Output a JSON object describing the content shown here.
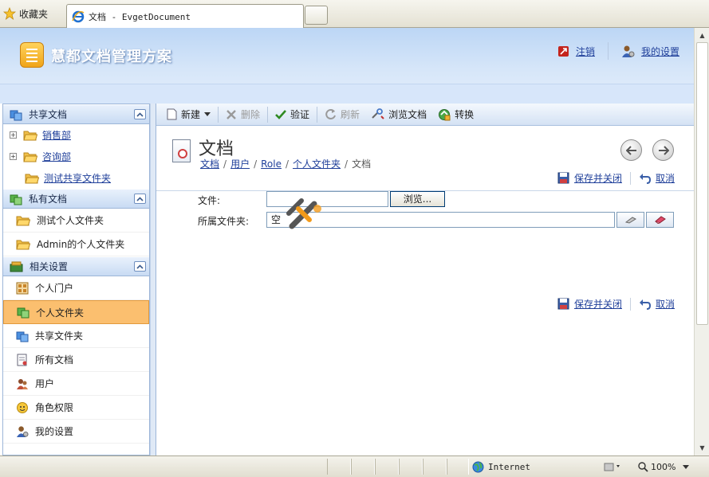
{
  "browser": {
    "favorites_label": "收藏夹",
    "tab_title": "文档 - EvgetDocument",
    "status_zone": "Internet",
    "zoom": "100%"
  },
  "header": {
    "app_title": "慧都文档管理方案",
    "logout": "注销",
    "my_settings": "我的设置"
  },
  "sidebar": {
    "shared_docs": {
      "title": "共享文档",
      "items": [
        "销售部",
        "咨询部",
        "测试共享文件夹"
      ]
    },
    "private_docs": {
      "title": "私有文档",
      "items": [
        "测试个人文件夹",
        "Admin的个人文件夹"
      ]
    },
    "settings": {
      "title": "相关设置",
      "items": [
        "个人门户",
        "个人文件夹",
        "共享文件夹",
        "所有文档",
        "用户",
        "角色权限",
        "我的设置"
      ]
    }
  },
  "toolbar": {
    "new": "新建",
    "delete": "删除",
    "verify": "验证",
    "refresh": "刷新",
    "browse_docs": "浏览文档",
    "convert": "转换"
  },
  "document": {
    "title": "文档",
    "breadcrumb": [
      "文档",
      "用户",
      "Role",
      "个人文件夹",
      "文档"
    ],
    "save_close": "保存并关闭",
    "cancel": "取消"
  },
  "form": {
    "file_label": "文件:",
    "browse_button": "浏览...",
    "folder_label": "所属文件夹:",
    "folder_value": "空"
  },
  "colors": {
    "active_nav": "#fbbf6f",
    "link": "#1f3f9a",
    "header_top": "#bcd6f5"
  }
}
